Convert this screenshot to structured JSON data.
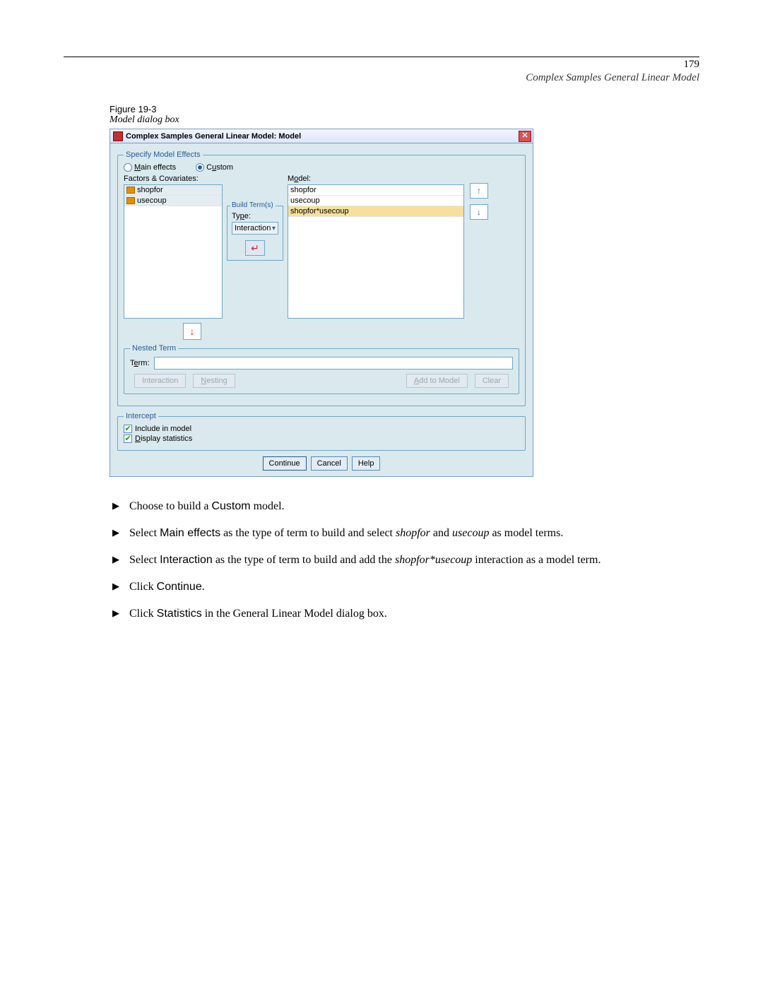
{
  "page": {
    "number": "179",
    "chapter": "Complex Samples General Linear Model"
  },
  "figure": {
    "label": "Figure 19-3",
    "description": "Model dialog box"
  },
  "dialog": {
    "title": "Complex Samples General Linear Model: Model",
    "specify_legend": "Specify Model Effects",
    "radio_main": "Main effects",
    "radio_custom": "Custom",
    "factors_label": "Factors & Covariates:",
    "factors": {
      "f1": "shopfor",
      "f2": "usecoup"
    },
    "build_terms_legend": "Build Term(s)",
    "type_label": "Type:",
    "type_value": "Interaction",
    "model_label": "Model:",
    "model_items": {
      "m1": "shopfor",
      "m2": "usecoup",
      "m3": "shopfor*usecoup"
    },
    "nested_legend": "Nested Term",
    "term_label": "Term:",
    "btn_interaction": "Interaction",
    "btn_nesting": "Nesting",
    "btn_add": "Add to Model",
    "btn_clear": "Clear",
    "intercept_legend": "Intercept",
    "chk_include": "Include in model",
    "chk_display": "Display statistics",
    "btn_continue": "Continue",
    "btn_cancel": "Cancel",
    "btn_help": "Help"
  },
  "steps": {
    "s1_pre": "Choose to build a ",
    "s1_sans": "Custom",
    "s1_post": " model.",
    "s2_pre": "Select ",
    "s2_sans": "Main effects",
    "s2_mid1": " as the type of term to build and select ",
    "s2_it1": "shopfor",
    "s2_mid2": " and ",
    "s2_it2": "usecoup",
    "s2_post": " as model terms.",
    "s3_pre": "Select ",
    "s3_sans": "Interaction",
    "s3_mid": " as the type of term to build and add the ",
    "s3_it": "shopfor*usecoup",
    "s3_post": " interaction as a model term.",
    "s4_pre": "Click ",
    "s4_sans": "Continue",
    "s4_post": ".",
    "s5_pre": "Click ",
    "s5_sans": "Statistics",
    "s5_post": " in the General Linear Model dialog box."
  }
}
